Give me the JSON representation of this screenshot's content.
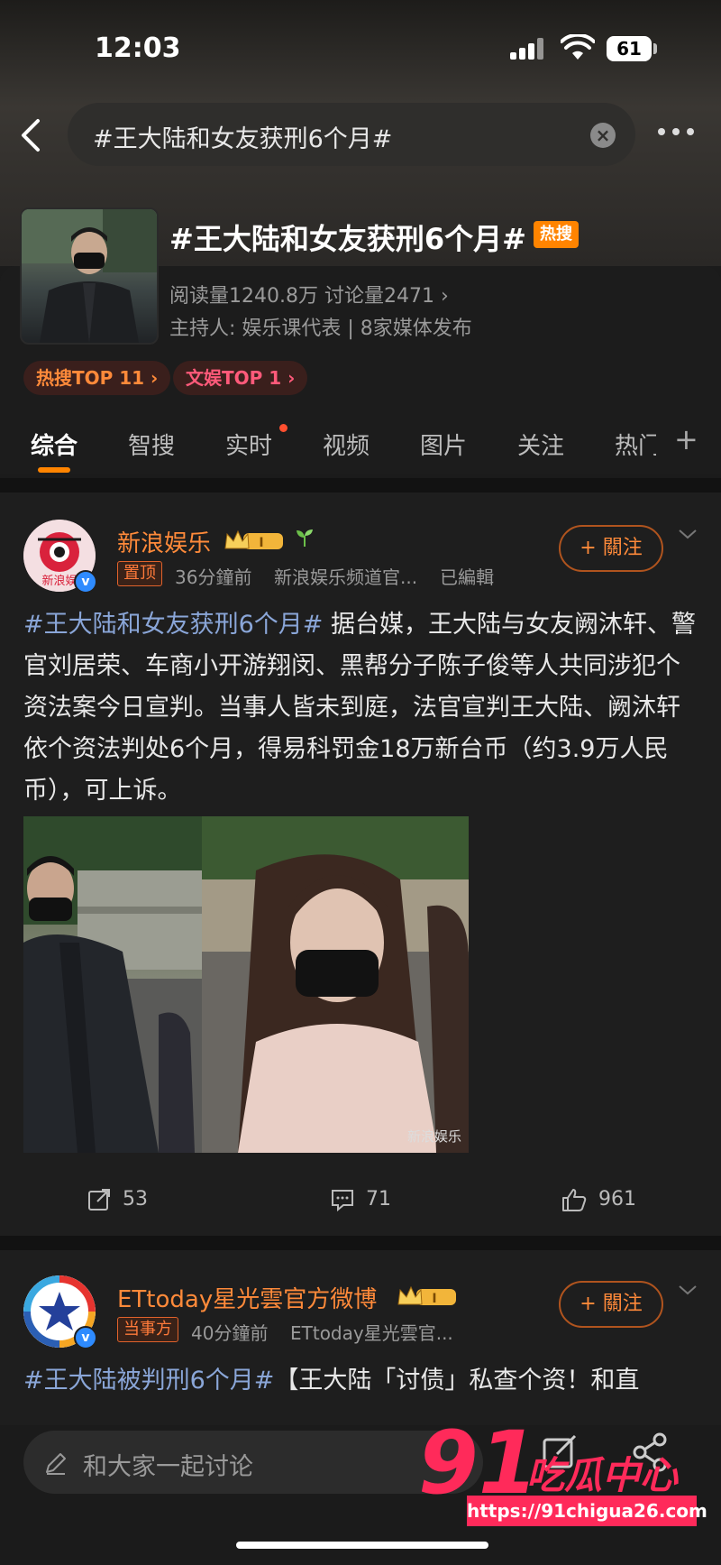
{
  "status": {
    "time": "12:03",
    "battery": "61"
  },
  "search": {
    "query": "#王大陆和女友获刑6个月#"
  },
  "topic": {
    "title": "#王大陆和女友获刑6个月#",
    "hot_badge": "热搜",
    "stats": "阅读量1240.8万  讨论量2471  ›",
    "host": "主持人: 娱乐课代表 | 8家媒体发布",
    "rank_hot": "热搜TOP 11 ›",
    "rank_ent": "文娱TOP 1 ›"
  },
  "tabs": [
    "综合",
    "智搜",
    "实时",
    "视频",
    "图片",
    "关注",
    "热门"
  ],
  "posts": [
    {
      "author": "新浪娱乐",
      "tag": "置顶",
      "time": "36分鐘前",
      "source": "新浪娱乐频道官...",
      "edited": "已編輯",
      "follow": "+ 關注",
      "hashtag": "#王大陆和女友获刑6个月#",
      "text": "据台媒，王大陆与女友阙沐轩、警官刘居荣、车商小开游翔闵、黑帮分子陈子俊等人共同涉犯个资法案今日宣判。当事人皆未到庭，法官宣判王大陆、阙沐轩依个资法判处6个月，得易科罚金18万新台币（约3.9万人民币），可上诉。",
      "image_watermark": "新浪娱乐",
      "reposts": "53",
      "comments": "71",
      "likes": "961"
    },
    {
      "author": "ETtoday星光雲官方微博",
      "tag": "当事方",
      "time": "40分鐘前",
      "source": "ETtoday星光雲官...",
      "follow": "+ 關注",
      "hashtag": "#王大陆被判刑6个月#",
      "text": "【王大陆「讨债」私查个资！和直"
    }
  ],
  "comment_bar": {
    "placeholder": "和大家一起讨论"
  },
  "watermark": {
    "brand": "91",
    "name": "吃瓜中心",
    "url": "https://91chigua26.com"
  },
  "colors": {
    "accent": "#ff8400",
    "hashtag": "#8aa6d8",
    "author": "#ff8a3a",
    "watermark": "#ff2a5a"
  }
}
